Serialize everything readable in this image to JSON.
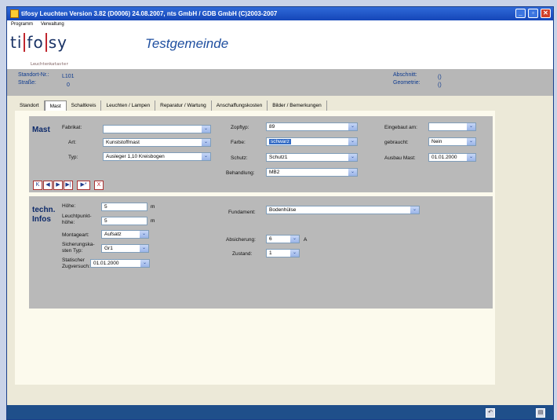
{
  "window": {
    "title": "tifosy Leuchten Version 3.82 (D0006) 24.08.2007, nts GmbH / GDB GmbH (C)2003-2007"
  },
  "menu": [
    "Programm",
    "Verwaltung"
  ],
  "logo": {
    "text_a": "ti",
    "text_b": "fo",
    "text_c": "sy",
    "sub": "Leuchtenkataster"
  },
  "gemeinde": "Testgemeinde",
  "info": {
    "standort_label": "Standort-Nr.:",
    "standort_value": "L101",
    "strasse_label": "Straße:",
    "strasse_value": "0",
    "abschnitt_label": "Abschnitt:",
    "abschnitt_value": "()",
    "geometrie_label": "Geometrie:",
    "geometrie_value": "()"
  },
  "tabs": [
    "Standort",
    "Mast",
    "Schaltkreis",
    "Leuchten / Lampen",
    "Reparatur / Wartung",
    "Anschaffungskosten",
    "Bilder / Bemerkungen"
  ],
  "active_tab": "Mast",
  "mast": {
    "title": "Mast",
    "fabrikat_label": "Fabrikat:",
    "fabrikat_value": "",
    "art_label": "Art:",
    "art_value": "Kunststoffmast",
    "typ_label": "Typ:",
    "typ_value": "Ausleger 1,10 Kreisbogen",
    "zopftyp_label": "Zopftyp:",
    "zopftyp_value": "89",
    "farbe_label": "Farbe:",
    "farbe_value": "schwarz",
    "schutz_label": "Schutz:",
    "schutz_value": "Schutz1",
    "behandlung_label": "Behandlung:",
    "behandlung_value": "MB2",
    "eingebaut_label": "Eingebaut am:",
    "eingebaut_value": "",
    "gebraucht_label": "gebraucht:",
    "gebraucht_value": "Nein",
    "ausbau_label": "Ausbau Mast:",
    "ausbau_value": "01.01.2000"
  },
  "techn": {
    "title_a": "techn.",
    "title_b": "Infos",
    "hoehe_label": "Höhe:",
    "hoehe_value": "5",
    "hoehe_unit": "m",
    "lph_label_a": "Leuchtpunkt-",
    "lph_label_b": "höhe:",
    "lph_value": "5",
    "lph_unit": "m",
    "montage_label": "Montageart:",
    "montage_value": "Aufsatz",
    "sich_label_a": "Sicherungska-",
    "sich_label_b": "sten Typ:",
    "sich_value": "Gr1",
    "stat_label_a": "Statischer",
    "stat_label_b": "Zugversuch:",
    "stat_value": "01.01.2000",
    "fundament_label": "Fundament:",
    "fundament_value": "Bodenhülse",
    "absicherung_label": "Absicherung:",
    "absicherung_value": "6",
    "absicherung_unit": "A",
    "zustand_label": "Zustand:",
    "zustand_value": "1"
  },
  "nav": {
    "first": "K",
    "prev": "◀",
    "next": "▶",
    "last": "▶|",
    "new": "▶*",
    "delete": "X"
  },
  "icons": {
    "undo": "undo-icon",
    "save": "save-icon"
  }
}
